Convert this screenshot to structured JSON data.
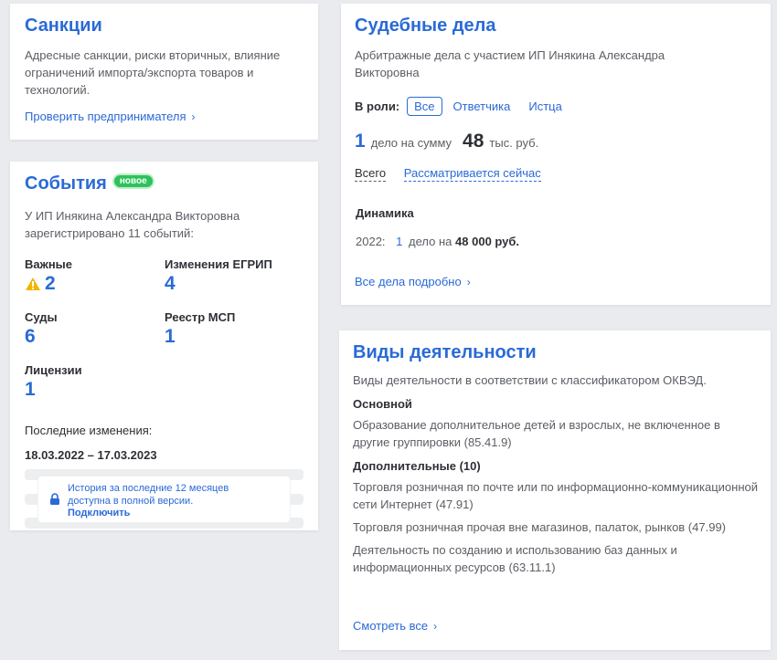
{
  "sanctions": {
    "title": "Санкции",
    "description": "Адресные санкции, риски вторичных, влияние ограничений импорта/экспорта товаров и технологий.",
    "link": "Проверить предпринимателя"
  },
  "events": {
    "title": "События",
    "badge": "новое",
    "description": "У ИП Инякина Александра Викторовна зарегистрировано 11 событий:",
    "stats": [
      {
        "label": "Важные",
        "value": "2"
      },
      {
        "label": "Изменения ЕГРИП",
        "value": "4"
      },
      {
        "label": "Суды",
        "value": "6"
      },
      {
        "label": "Реестр МСП",
        "value": "1"
      },
      {
        "label": "Лицензии",
        "value": "1"
      }
    ],
    "last_changes_label": "Последние изменения:",
    "last_changes_dates": "18.03.2022 – 17.03.2023",
    "lock_text": "История за последние 12 месяцев доступна в полной версии.",
    "lock_link": "Подключить"
  },
  "court": {
    "title": "Судебные дела",
    "description": "Арбитражные дела с участием ИП Инякина Александра Викторовна",
    "roles_label": "В роли:",
    "roles": [
      "Все",
      "Ответчика",
      "Истца"
    ],
    "case_count": "1",
    "case_text": "дело на сумму",
    "sum": "48",
    "sum_unit": "тыс. руб.",
    "tab_all": "Всего",
    "tab_active": "Рассматривается сейчас",
    "dynamics_label": "Динамика",
    "dynamics_year": "2022:",
    "dynamics_count": "1",
    "dynamics_text": "дело на",
    "dynamics_sum": "48 000 руб.",
    "link": "Все дела подробно"
  },
  "activities": {
    "title": "Виды деятельности",
    "description": "Виды деятельности в соответствии с классификатором ОКВЭД.",
    "main_label": "Основной",
    "main_item": "Образование дополнительное детей и взрослых, не включенное в другие группировки (85.41.9)",
    "extra_label": "Дополнительные (10)",
    "extra_items": [
      "Торговля розничная по почте или по информационно-коммуникационной сети Интернет (47.91)",
      "Торговля розничная прочая вне магазинов, палаток, рынков (47.99)",
      "Деятельность по созданию и использованию баз данных и информационных ресурсов (63.11.1)"
    ],
    "link": "Смотреть все"
  },
  "colors": {
    "accent": "#2a6ad6",
    "badge": "#2fc15b",
    "warning": "#f2b400"
  }
}
